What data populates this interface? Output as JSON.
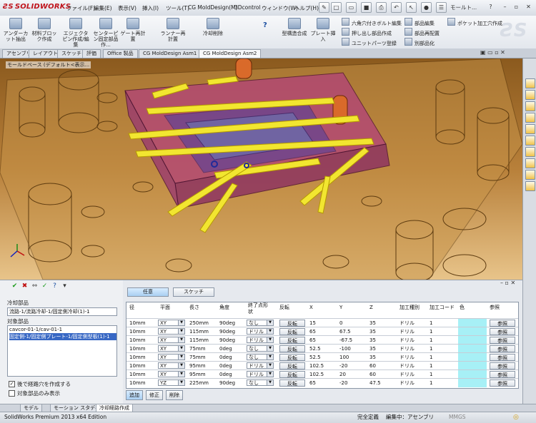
{
  "app": {
    "logo": "SOLIDWORKS"
  },
  "menu": [
    "ファイル(F)",
    "編集(E)",
    "表示(V)",
    "挿入(I)",
    "ツール(T)",
    "CG MoldDesign(M)",
    "3Dcontrol",
    "ウィンドウ(W)",
    "ヘルプ(H)"
  ],
  "search": {
    "text": "モールト..."
  },
  "ribbon": {
    "big_buttons": [
      "アンダーカット抽出",
      "材料ブロック作成",
      "エジェクタピン作成/編集",
      "センターピン固定部品作...",
      "ゲート再計置",
      "ランナー再計置",
      "冷却削除",
      "型構造合成",
      "プレート挿入"
    ],
    "small_buttons": [
      "六角穴付きボルト編集",
      "押し出し部品作成",
      "ユニットパーツ登録",
      "部品編集",
      "部品再配置",
      "別部品化",
      "ポケット加工穴作成"
    ]
  },
  "tabs": [
    "アセンブリ",
    "レイアウト",
    "スケッチ",
    "評価",
    "Office 製品",
    "CG MoldDesign Asm1",
    "CG MoldDesign Asm2"
  ],
  "viewport": {
    "tree_item": "モールドベース (デフォルト<表示..."
  },
  "pm": {
    "section1": "冷却部品",
    "field1": "流路-1/流路冷却-1/固定側冷却(1)-1",
    "section2": "対象部品",
    "list": [
      "cavcor-01-1/cav-01-1",
      "固定側-1/固定側プレート-1/固定側型板(1)-1"
    ],
    "chk1": "後で経路穴を作成する",
    "chk2": "対象部品のみ表示"
  },
  "panel": {
    "tab_free": "任意",
    "tab_sketch": "スケッチ",
    "headers": [
      "径",
      "平面",
      "長さ",
      "角度",
      "終了点形状",
      "反転",
      "X",
      "Y",
      "Z",
      "加工種別",
      "加工コード",
      "色",
      "参照"
    ],
    "rows": [
      {
        "d": "10mm",
        "plane": "XY",
        "len": "250mm",
        "ang": "90deg",
        "end": "なし",
        "flip": "反転",
        "x": "15",
        "y": "0",
        "z": "35",
        "kind": "ドリル",
        "code": "1",
        "ref": "参照"
      },
      {
        "d": "10mm",
        "plane": "XY",
        "len": "115mm",
        "ang": "90deg",
        "end": "ドリル",
        "flip": "反転",
        "x": "65",
        "y": "67.5",
        "z": "35",
        "kind": "ドリル",
        "code": "1",
        "ref": "参照"
      },
      {
        "d": "10mm",
        "plane": "XY",
        "len": "115mm",
        "ang": "90deg",
        "end": "ドリル",
        "flip": "反転",
        "x": "65",
        "y": "-67.5",
        "z": "35",
        "kind": "ドリル",
        "code": "1",
        "ref": "参照"
      },
      {
        "d": "10mm",
        "plane": "XY",
        "len": "75mm",
        "ang": "0deg",
        "end": "なし",
        "flip": "反転",
        "x": "52.5",
        "y": "-100",
        "z": "35",
        "kind": "ドリル",
        "code": "1",
        "ref": "参照"
      },
      {
        "d": "10mm",
        "plane": "XY",
        "len": "75mm",
        "ang": "0deg",
        "end": "なし",
        "flip": "反転",
        "x": "52.5",
        "y": "100",
        "z": "35",
        "kind": "ドリル",
        "code": "1",
        "ref": "参照"
      },
      {
        "d": "10mm",
        "plane": "XY",
        "len": "95mm",
        "ang": "0deg",
        "end": "ドリル",
        "flip": "反転",
        "x": "102.5",
        "y": "-20",
        "z": "60",
        "kind": "ドリル",
        "code": "1",
        "ref": "参照"
      },
      {
        "d": "10mm",
        "plane": "XY",
        "len": "95mm",
        "ang": "0deg",
        "end": "ドリル",
        "flip": "反転",
        "x": "102.5",
        "y": "20",
        "z": "60",
        "kind": "ドリル",
        "code": "1",
        "ref": "参照"
      },
      {
        "d": "10mm",
        "plane": "YZ",
        "len": "225mm",
        "ang": "90deg",
        "end": "なし",
        "flip": "反転",
        "x": "65",
        "y": "-20",
        "z": "47.5",
        "kind": "ドリル",
        "code": "1",
        "ref": "参照"
      }
    ],
    "btn_add": "追加",
    "btn_modify": "修正",
    "btn_delete": "削除"
  },
  "bottom_tabs": [
    "モデル",
    "モーション スタディ 1",
    "冷却経路作成"
  ],
  "status": {
    "left": "SolidWorks Premium 2013 x64 Edition",
    "state": "完全定義",
    "editing": "編集中：アセンブリ",
    "units": "MMGS"
  }
}
